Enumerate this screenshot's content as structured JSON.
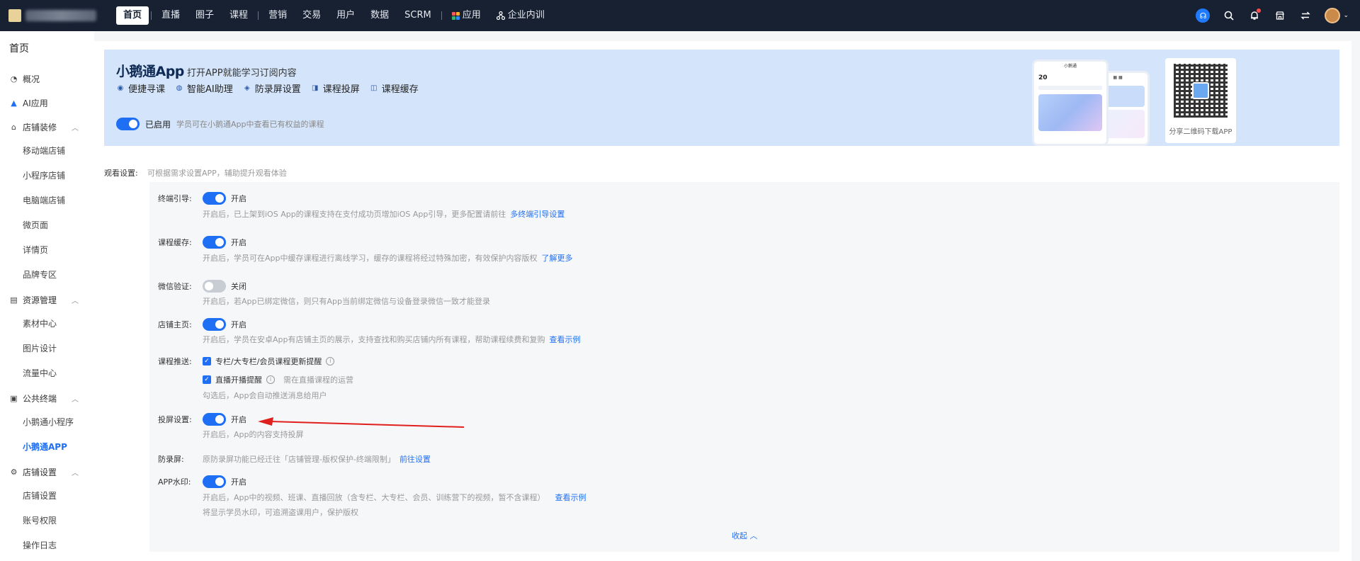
{
  "topbar": {
    "nav": [
      {
        "label": "首页",
        "active": true
      },
      {
        "label": "直播"
      },
      {
        "label": "圈子"
      },
      {
        "label": "课程"
      },
      {
        "label": "营销"
      },
      {
        "label": "交易"
      },
      {
        "label": "用户"
      },
      {
        "label": "数据"
      },
      {
        "label": "SCRM"
      },
      {
        "label": "应用"
      },
      {
        "label": "企业内训"
      }
    ],
    "icons": [
      "headset-icon",
      "search-icon",
      "bell-icon",
      "store-icon",
      "switch-icon",
      "avatar",
      "chevron-down-icon"
    ]
  },
  "sidebar": {
    "title": "首页",
    "items": [
      {
        "type": "top",
        "label": "概况",
        "icon": "chart-icon"
      },
      {
        "type": "top",
        "label": "AI应用",
        "icon": "ai-icon"
      },
      {
        "type": "group",
        "label": "店铺装修",
        "icon": "shop-icon"
      },
      {
        "type": "item",
        "label": "移动端店铺"
      },
      {
        "type": "item",
        "label": "小程序店铺"
      },
      {
        "type": "item",
        "label": "电脑端店铺"
      },
      {
        "type": "item",
        "label": "微页面"
      },
      {
        "type": "item",
        "label": "详情页"
      },
      {
        "type": "item",
        "label": "品牌专区"
      },
      {
        "type": "group",
        "label": "资源管理",
        "icon": "resource-icon"
      },
      {
        "type": "item",
        "label": "素材中心"
      },
      {
        "type": "item",
        "label": "图片设计"
      },
      {
        "type": "item",
        "label": "流量中心"
      },
      {
        "type": "group",
        "label": "公共终端",
        "icon": "terminal-icon"
      },
      {
        "type": "item",
        "label": "小鹅通小程序"
      },
      {
        "type": "item",
        "label": "小鹅通APP",
        "active": true
      },
      {
        "type": "group",
        "label": "店铺设置",
        "icon": "gear-icon"
      },
      {
        "type": "item",
        "label": "店铺设置"
      },
      {
        "type": "item",
        "label": "账号权限"
      },
      {
        "type": "item",
        "label": "操作日志"
      }
    ]
  },
  "banner": {
    "brand": "小鹅通App",
    "subtitle": "打开APP就能学习订阅内容",
    "features": [
      "便捷寻课",
      "智能AI助理",
      "防录屏设置",
      "课程投屏",
      "课程缓存"
    ],
    "enabled_label": "已启用",
    "enabled_desc": "学员可在小鹅通App中查看已有权益的课程",
    "qr_caption": "分享二维码下载APP"
  },
  "viewing": {
    "label": "观看设置:",
    "desc": "可根据需求设置APP，辅助提升观看体验"
  },
  "settings": {
    "terminal_guide": {
      "label": "终端引导:",
      "state": "开启",
      "help": "开启后，已上架到iOS App的课程支持在支付成功页增加iOS App引导，更多配置请前往",
      "link": "多终端引导设置"
    },
    "course_cache": {
      "label": "课程缓存:",
      "state": "开启",
      "help": "开启后，学员可在App中缓存课程进行离线学习，缓存的课程将经过特殊加密，有效保护内容版权",
      "link": "了解更多"
    },
    "wechat_verify": {
      "label": "微信验证:",
      "state": "关闭",
      "help": "开启后，若App已绑定微信，则只有App当前绑定微信与设备登录微信一致才能登录"
    },
    "shop_home": {
      "label": "店铺主页:",
      "state": "开启",
      "help": "开启后，学员在安卓App有店铺主页的展示，支持查找和购买店铺内所有课程，帮助课程续费和复购",
      "link": "查看示例"
    },
    "course_push": {
      "label": "课程推送:",
      "opt1": "专栏/大专栏/会员课程更新提醒",
      "opt2": "直播开播提醒",
      "opt2_note": "需在直播课程的运营",
      "help": "勾选后，App会自动推送消息给用户"
    },
    "cast": {
      "label": "投屏设置:",
      "state": "开启",
      "help": "开启后，App的内容支持投屏"
    },
    "anti_record": {
      "label": "防录屏:",
      "help": "原防录屏功能已经迁往「店铺管理-版权保护-终端限制」",
      "link": "前往设置"
    },
    "watermark": {
      "label": "APP水印:",
      "state": "开启",
      "help1": "开启后，App中的视频、班课、直播回放（含专栏、大专栏、会员、训练营下的视频，暂不含课程）",
      "link": "查看示例",
      "help2": "将显示学员水印，可追溯盗课用户，保护版权"
    },
    "collapse": "收起"
  },
  "phone_mock": {
    "title": "小鹅通",
    "big_num": "20"
  },
  "colors": {
    "topbar": "#172132",
    "accent": "#1f6ff5",
    "banner": "#d4e5fb",
    "arrow": "#e0201d"
  }
}
